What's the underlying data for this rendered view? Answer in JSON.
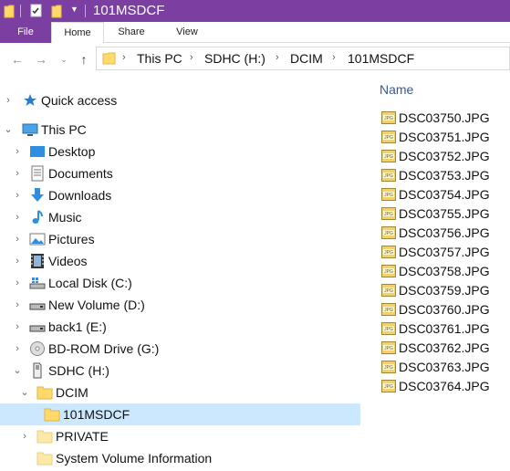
{
  "window": {
    "title": "101MSDCF"
  },
  "ribbon": {
    "tabs": [
      "File",
      "Home",
      "Share",
      "View"
    ]
  },
  "address": {
    "crumbs": [
      "This PC",
      "SDHC (H:)",
      "DCIM",
      "101MSDCF"
    ]
  },
  "nav": {
    "items": [
      {
        "label": "Quick access",
        "icon": "star-icon"
      },
      {
        "label": "This PC",
        "icon": "computer-icon"
      },
      {
        "label": "Desktop",
        "icon": "desktop-icon"
      },
      {
        "label": "Documents",
        "icon": "documents-icon"
      },
      {
        "label": "Downloads",
        "icon": "downloads-icon"
      },
      {
        "label": "Music",
        "icon": "music-icon"
      },
      {
        "label": "Pictures",
        "icon": "pictures-icon"
      },
      {
        "label": "Videos",
        "icon": "videos-icon"
      },
      {
        "label": "Local Disk (C:)",
        "icon": "local-disk-icon"
      },
      {
        "label": "New Volume (D:)",
        "icon": "drive-icon"
      },
      {
        "label": "back1 (E:)",
        "icon": "drive-icon"
      },
      {
        "label": "BD-ROM Drive (G:)",
        "icon": "disc-icon"
      },
      {
        "label": "SDHC (H:)",
        "icon": "sd-card-icon"
      },
      {
        "label": "DCIM",
        "icon": "folder-icon"
      },
      {
        "label": "101MSDCF",
        "icon": "folder-icon"
      },
      {
        "label": "PRIVATE",
        "icon": "folder-icon"
      },
      {
        "label": "System Volume Information",
        "icon": "folder-icon"
      }
    ]
  },
  "filelist": {
    "column_name": "Name",
    "files": [
      "DSC03750.JPG",
      "DSC03751.JPG",
      "DSC03752.JPG",
      "DSC03753.JPG",
      "DSC03754.JPG",
      "DSC03755.JPG",
      "DSC03756.JPG",
      "DSC03757.JPG",
      "DSC03758.JPG",
      "DSC03759.JPG",
      "DSC03760.JPG",
      "DSC03761.JPG",
      "DSC03762.JPG",
      "DSC03763.JPG",
      "DSC03764.JPG"
    ]
  },
  "colors": {
    "titlebar": "#7a3fa0",
    "selection": "#cce8ff",
    "folder": "#ffd96a"
  }
}
